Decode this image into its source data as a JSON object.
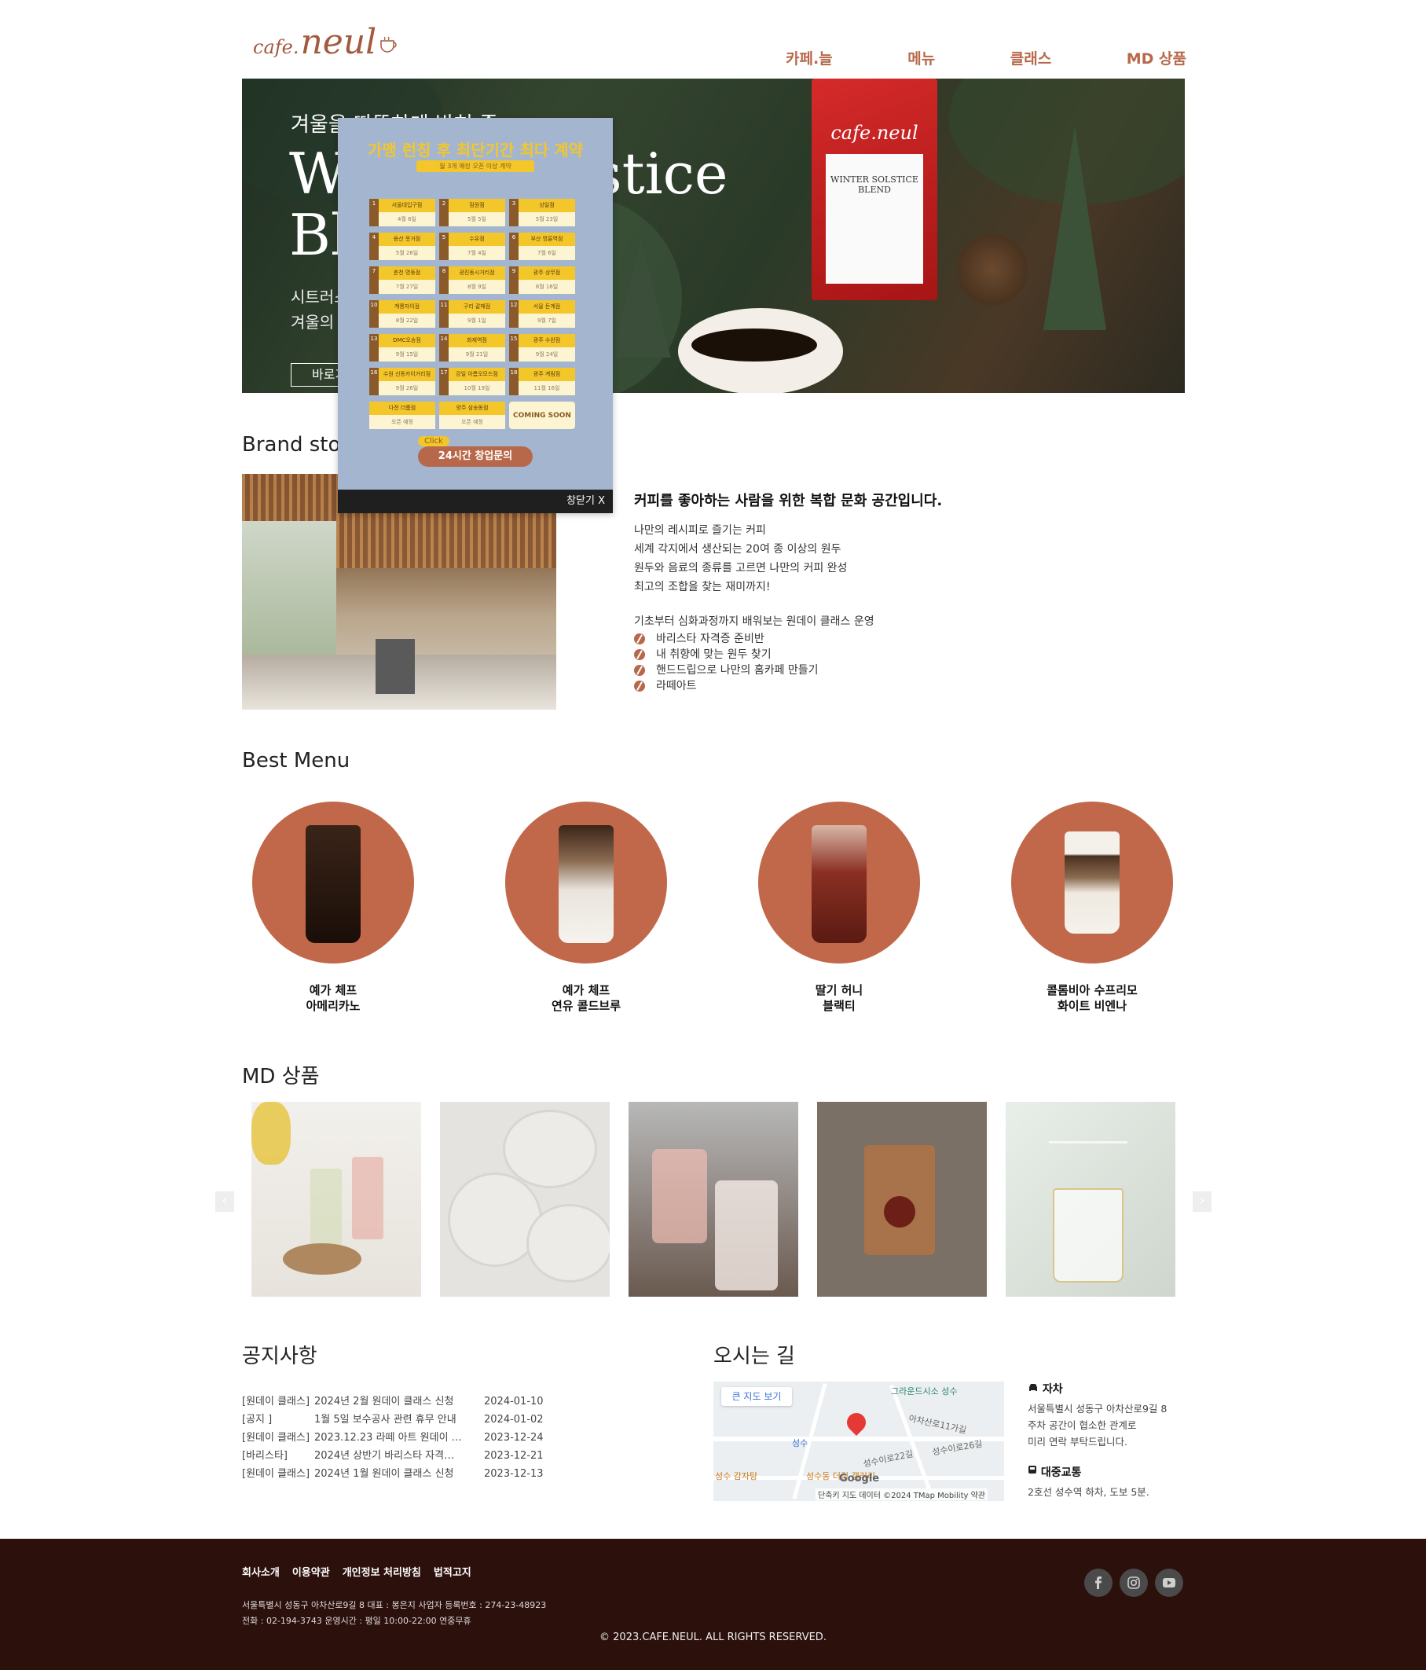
{
  "header": {
    "logo_small": "cafe.",
    "logo_big": "neul",
    "nav": [
      "카페.늘",
      "메뉴",
      "클래스",
      "MD 상품"
    ]
  },
  "hero": {
    "subtitle": "겨울을 따뜻하게 밝혀 줄",
    "title_line1": "Winter Solstice",
    "title_line2": "Blend",
    "desc_line1": "시트러스",
    "desc_line2": "겨울의",
    "button": "바로가기",
    "bag_brand": "cafe.neul",
    "bag_label_title": "WINTER SOLSTICE BLEND"
  },
  "popup": {
    "title": "가맹 런칭 후 최단기간 최다 계약",
    "subtitle": "월 3개 매장 오픈 이상 계약",
    "stores": [
      {
        "num": "1",
        "name": "서울대입구점",
        "date": "4월 6일"
      },
      {
        "num": "2",
        "name": "잠원점",
        "date": "5월 5일"
      },
      {
        "num": "3",
        "name": "상일점",
        "date": "5월 23일"
      },
      {
        "num": "4",
        "name": "용산 뭇거점",
        "date": "5월 26일"
      },
      {
        "num": "5",
        "name": "수유점",
        "date": "7월 4일"
      },
      {
        "num": "6",
        "name": "부산 명륜역점",
        "date": "7월 6일"
      },
      {
        "num": "7",
        "name": "춘천 명동점",
        "date": "7월 27일"
      },
      {
        "num": "8",
        "name": "광진동시거리점",
        "date": "8월 9일"
      },
      {
        "num": "9",
        "name": "광주 상무점",
        "date": "8월 16일"
      },
      {
        "num": "10",
        "name": "계룡자이점",
        "date": "8월 22일"
      },
      {
        "num": "11",
        "name": "구리 갈매점",
        "date": "9월 1일"
      },
      {
        "num": "12",
        "name": "서울 돈계점",
        "date": "9월 7일"
      },
      {
        "num": "13",
        "name": "DMC오송점",
        "date": "9월 15일"
      },
      {
        "num": "14",
        "name": "화재역점",
        "date": "9월 21일"
      },
      {
        "num": "15",
        "name": "광주 수완점",
        "date": "9월 24일"
      },
      {
        "num": "16",
        "name": "수원 신동카이거리점",
        "date": "9월 26일"
      },
      {
        "num": "17",
        "name": "강일 아름오모드점",
        "date": "10월 19일"
      },
      {
        "num": "18",
        "name": "광주 계림점",
        "date": "11월 16일"
      },
      {
        "num": "",
        "name": "다전 더룸점",
        "date": "오픈 예정"
      },
      {
        "num": "",
        "name": "양주 삼송동점",
        "date": "오픈 예정"
      }
    ],
    "coming_soon": "COMING SOON",
    "click_label": "Click",
    "cta": "24시간 창업문의",
    "close": "창닫기 X"
  },
  "brand": {
    "section_title": "Brand story",
    "heading": "커피를 좋아하는 사람을 위한 복합 문화 공간입니다.",
    "lines": [
      "나만의 레시피로 즐기는 커피",
      "세계 각지에서 생산되는 20여 종 이상의 원두",
      "원두와 음료의 종류를 고르면 나만의 커피 완성",
      "최고의 조합을 찾는 재미까지!"
    ],
    "class_intro": "기초부터 심화과정까지 배워보는 원데이 클래스 운영",
    "classes": [
      "바리스타 자격증 준비반",
      "내 취향에 맞는 원두 찾기",
      "핸드드립으로 나만의 홈카페 만들기",
      "라떼아트"
    ]
  },
  "best_menu": {
    "section_title": "Best Menu",
    "items": [
      {
        "line1": "예가 체프",
        "line2": "아메리카노"
      },
      {
        "line1": "예가 체프",
        "line2": "연유 콜드브루"
      },
      {
        "line1": "딸기 허니",
        "line2": "블랙티"
      },
      {
        "line1": "콜롬비아 수프리모",
        "line2": "화이트 비엔나"
      }
    ]
  },
  "md": {
    "section_title": "MD 상품",
    "prev": "‹",
    "next": "›"
  },
  "notices": {
    "section_title": "공지사항",
    "rows": [
      {
        "category": "[원데이 클래스]",
        "title": "2024년 2월 원데이 클래스 신청",
        "date": "2024-01-10"
      },
      {
        "category": "[공지 ]",
        "title": "1월 5일 보수공사 관련 휴무 안내",
        "date": "2024-01-02"
      },
      {
        "category": "[원데이 클래스]",
        "title": "2023.12.23 라떼 아트 원데이 …",
        "date": "2023-12-24"
      },
      {
        "category": "[바리스타]",
        "title": "2024년 상반기 바리스타 자격…",
        "date": "2023-12-21"
      },
      {
        "category": "[원데이 클래스]",
        "title": "2024년 1월 원데이 클래스 신청",
        "date": "2023-12-13"
      }
    ]
  },
  "location": {
    "section_title": "오시는 길",
    "map_button": "큰 지도 보기",
    "map_labels": [
      "그라운드시소 성수",
      "아차산로11가길",
      "성수이로26길",
      "성수이로22길",
      "성수",
      "성수 감자탕",
      "성수동 더링 갤러리"
    ],
    "map_google": "Google",
    "map_credit": "단축키  지도 데이터 ©2024 TMap Mobility  약관",
    "car_title": "자차",
    "car_lines": [
      "서울특별시 성동구 아차산로9길 8",
      "주차 공간이 협소한 관계로",
      "미리 연락 부탁드립니다."
    ],
    "transit_title": "대중교통",
    "transit_text": "2호선 성수역 하차, 도보 5분."
  },
  "footer": {
    "links": [
      "회사소개",
      "이용약관",
      "개인정보 처리방침",
      "법적고지"
    ],
    "info_line1": "서울특별시 성동구 아차산로9길 8     대표 : 봉은지     사업자 등록번호 : 274-23-48923",
    "info_line2": "전화 : 02-194-3743     운영시간 : 평일 10:00-22:00 연중무휴",
    "copyright": "© 2023.CAFE.NEUL. ALL RIGHTS RESERVED.",
    "social": [
      "facebook-icon",
      "instagram-icon",
      "youtube-icon"
    ]
  },
  "colors": {
    "accent": "#c1684b",
    "nav": "#b8684a",
    "footer_bg": "#2c100c",
    "popup_bg": "#a4b6cf",
    "popup_yellow": "#f3c62a"
  }
}
